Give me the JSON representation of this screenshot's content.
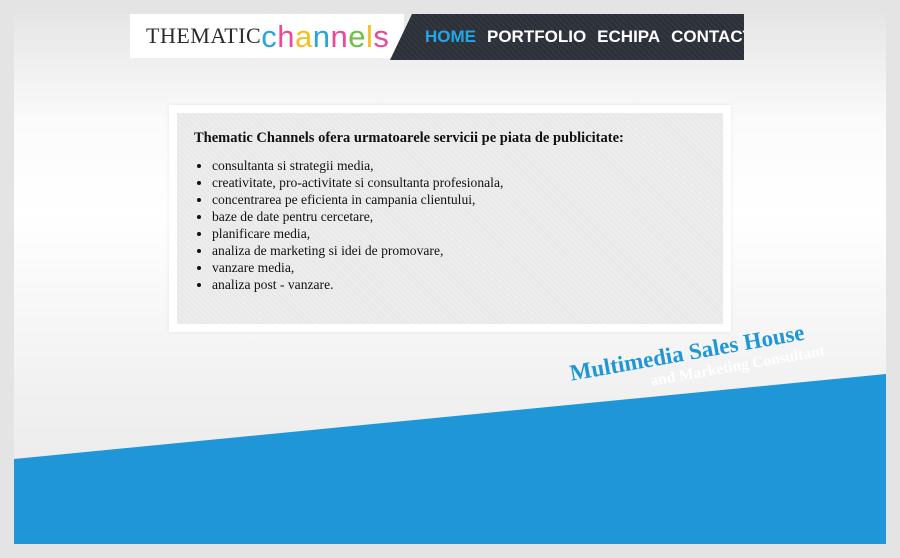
{
  "header": {
    "logo": {
      "part1": "THEMATIC",
      "part2_letters": [
        {
          "ch": "c",
          "color": "#2aa3df"
        },
        {
          "ch": "h",
          "color": "#e9499b"
        },
        {
          "ch": "a",
          "color": "#f2c023"
        },
        {
          "ch": "n",
          "color": "#2aa3df"
        },
        {
          "ch": "n",
          "color": "#e9499b"
        },
        {
          "ch": "e",
          "color": "#6fbf45"
        },
        {
          "ch": "l",
          "color": "#f2c023"
        },
        {
          "ch": "s",
          "color": "#e9499b"
        }
      ]
    },
    "nav": {
      "home": "HOME",
      "portfolio": "PORTFOLIO",
      "echipa": "ECHIPA",
      "contact": "CONTACT",
      "active": "home"
    }
  },
  "content": {
    "heading": "Thematic Channels ofera urmatoarele servicii pe piata de publicitate:",
    "services": [
      "consultanta si strategii media,",
      "creativitate, pro-activitate si consultanta profesionala,",
      "concentrarea pe eficienta in campania clientului,",
      "baze de date pentru cercetare,",
      "planificare media,",
      "analiza de marketing si idei de promovare,",
      "vanzare media,",
      "analiza post - vanzare."
    ]
  },
  "tagline": {
    "main": "Multimedia Sales House",
    "sub": "and Marketing Consultant"
  },
  "colors": {
    "accent_blue": "#1e96d8",
    "nav_bg": "#2b2f38",
    "nav_active": "#22a7e6"
  }
}
